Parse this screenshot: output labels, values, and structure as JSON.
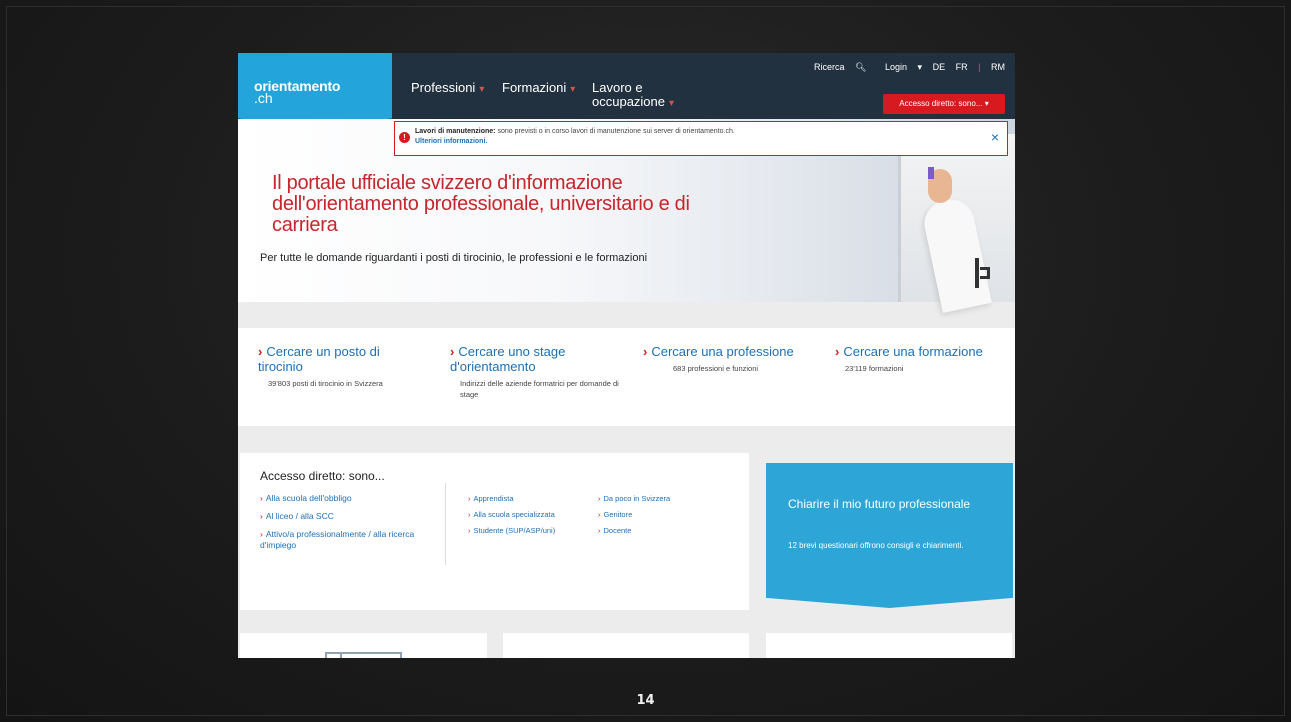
{
  "page_number": "14",
  "header": {
    "logo_line1": "orientamento",
    "logo_line2": ".ch",
    "nav": [
      {
        "label": "Professioni"
      },
      {
        "label": "Formazioni"
      },
      {
        "label": "Lavoro e",
        "label2": "occupazione"
      }
    ],
    "utility": {
      "search": "Ricerca",
      "login": "Login",
      "lang_de": "DE",
      "lang_fr": "FR",
      "lang_rm": "RM"
    },
    "direct_access_button": "Accesso diretto: sono..."
  },
  "notice": {
    "title": "Lavori di manutenzione:",
    "text": "sono previsti o in corso lavori di manutenzione sui server di orientamento.ch.",
    "link": "Ulteriori informazioni.",
    "close": "×"
  },
  "hero": {
    "title": "Il portale ufficiale svizzero d'informazione dell'orientamento professionale, universitario e di carriera",
    "subtitle": "Per tutte le domande riguardanti i posti di tirocinio, le professioni e le formazioni"
  },
  "search_links": [
    {
      "title": "Cercare un posto di tirocinio",
      "sub": "39'803 posti di tirocinio in Svizzera"
    },
    {
      "title": "Cercare uno stage d'orientamento",
      "sub": "Indirizzi delle aziende formatrici per domande di stage"
    },
    {
      "title": "Cercare una professione",
      "sub": "683 professioni e funzioni"
    },
    {
      "title": "Cercare una formazione",
      "sub": "23'119 formazioni"
    }
  ],
  "access": {
    "heading": "Accesso diretto: sono...",
    "col1": [
      "Alla scuola dell'obbligo",
      "Al liceo / alla SCC",
      "Attivo/a professionalmente / alla ricerca d'impiego"
    ],
    "col2": [
      "Apprendista",
      "Alla scuola specializzata",
      "Studente (SUP/ASP/uni)"
    ],
    "col3": [
      "Da poco in Svizzera",
      "Genitore",
      "Docente"
    ]
  },
  "blue_card": {
    "title": "Chiarire il mio futuro professionale",
    "text": "12 brevi questionari offrono consigli e chiarimenti."
  },
  "colors": {
    "brand_blue": "#23a5dc",
    "nav_dark": "#223140",
    "accent_red": "#d71920",
    "link_blue": "#1e6fb6"
  }
}
